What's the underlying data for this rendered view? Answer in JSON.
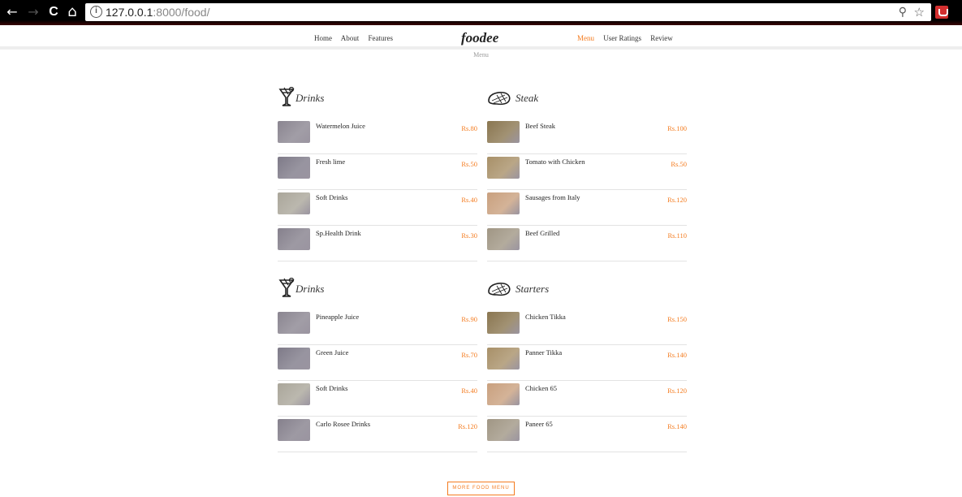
{
  "browser": {
    "back_glyph": "←",
    "forward_glyph": "→",
    "reload_glyph": "C",
    "home_glyph": "⌂",
    "info_glyph": "i",
    "url_host": "127.0.0.1",
    "url_path": ":8000/food/",
    "zoom_glyph": "⚲",
    "star_glyph": "☆"
  },
  "header": {
    "nav_left": [
      "Home",
      "About",
      "Features"
    ],
    "logo": "foodee",
    "nav_right": [
      "Menu",
      "User Ratings",
      "Review"
    ],
    "active": "Menu",
    "subtitle": "Menu"
  },
  "menu": {
    "left": [
      {
        "title": "Drinks",
        "icon": "cocktail-icon",
        "items": [
          {
            "name": "Watermelon Juice",
            "price": "Rs.80",
            "thumb": "#8a8590"
          },
          {
            "name": "Fresh lime",
            "price": "Rs.50",
            "thumb": "#7e7a88"
          },
          {
            "name": "Soft Drinks",
            "price": "Rs.40",
            "thumb": "#aaa69a"
          },
          {
            "name": "Sp.Health Drink",
            "price": "Rs.30",
            "thumb": "#85808c"
          }
        ]
      },
      {
        "title": "Drinks",
        "icon": "cocktail-icon",
        "items": [
          {
            "name": "Pineapple Juice",
            "price": "Rs.90",
            "thumb": "#8a8590"
          },
          {
            "name": "Green Juice",
            "price": "Rs.70",
            "thumb": "#7e7a88"
          },
          {
            "name": "Soft Drinks",
            "price": "Rs.40",
            "thumb": "#aaa69a"
          },
          {
            "name": "Carlo Rosee Drinks",
            "price": "Rs.120",
            "thumb": "#85808c"
          }
        ]
      }
    ],
    "right": [
      {
        "title": "Steak",
        "icon": "steak-icon",
        "items": [
          {
            "name": "Beef Steak",
            "price": "Rs.100",
            "thumb": "#8a7650"
          },
          {
            "name": "Tomato with Chicken",
            "price": "Rs.50",
            "thumb": "#a89068"
          },
          {
            "name": "Sausages from Italy",
            "price": "Rs.120",
            "thumb": "#c9a07e"
          },
          {
            "name": "Beef Grilled",
            "price": "Rs.110",
            "thumb": "#a09684"
          }
        ]
      },
      {
        "title": "Starters",
        "icon": "steak-icon",
        "items": [
          {
            "name": "Chicken Tikka",
            "price": "Rs.150",
            "thumb": "#8a7650"
          },
          {
            "name": "Panner Tikka",
            "price": "Rs.140",
            "thumb": "#a89068"
          },
          {
            "name": "Chicken 65",
            "price": "Rs.120",
            "thumb": "#c9a07e"
          },
          {
            "name": "Paneer 65",
            "price": "Rs.140",
            "thumb": "#a09684"
          }
        ]
      }
    ]
  },
  "more_button": "MORE FOOD MENU",
  "colors": {
    "accent": "#f47c20"
  }
}
